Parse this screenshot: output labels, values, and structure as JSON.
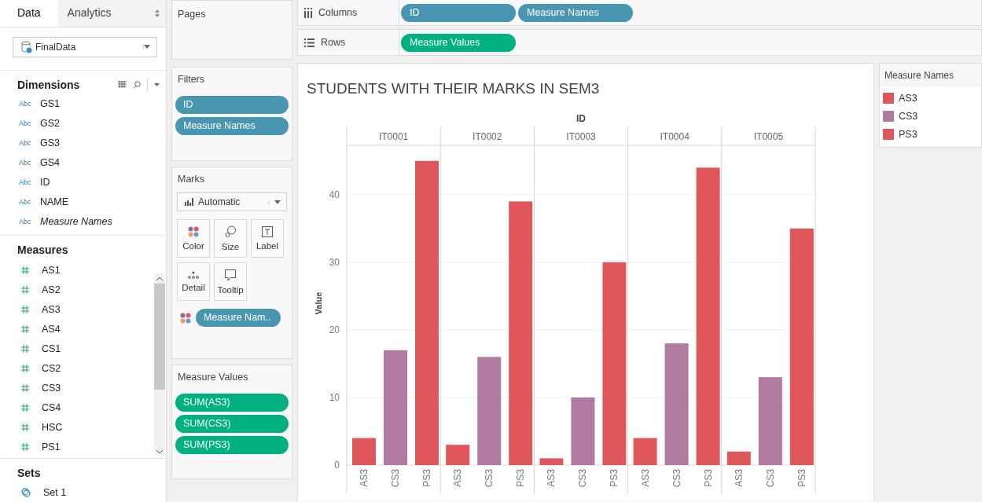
{
  "sidebar": {
    "tabs": [
      {
        "label": "Data",
        "selected": true
      },
      {
        "label": "Analytics",
        "selected": false
      }
    ],
    "data_source": "FinalData",
    "dimensions": {
      "title": "Dimensions",
      "items": [
        {
          "type_label": "Abc",
          "name": "GS1",
          "italic": false
        },
        {
          "type_label": "Abc",
          "name": "GS2",
          "italic": false
        },
        {
          "type_label": "Abc",
          "name": "GS3",
          "italic": false
        },
        {
          "type_label": "Abc",
          "name": "GS4",
          "italic": false
        },
        {
          "type_label": "Abc",
          "name": "ID",
          "italic": false
        },
        {
          "type_label": "Abc",
          "name": "NAME",
          "italic": false
        },
        {
          "type_label": "Abc",
          "name": "Measure Names",
          "italic": true
        }
      ]
    },
    "measures": {
      "title": "Measures",
      "items": [
        "AS1",
        "AS2",
        "AS3",
        "AS4",
        "CS1",
        "CS2",
        "CS3",
        "CS4",
        "HSC",
        "PS1"
      ]
    },
    "sets": {
      "title": "Sets",
      "items": [
        "Set 1"
      ]
    }
  },
  "pages": {
    "title": "Pages"
  },
  "filters": {
    "title": "Filters",
    "pills": [
      "ID",
      "Measure Names"
    ]
  },
  "marks": {
    "title": "Marks",
    "mark_type": "Automatic",
    "cards": [
      {
        "kind": "color",
        "label": "Color"
      },
      {
        "kind": "size",
        "label": "Size"
      },
      {
        "kind": "label",
        "label": "Label"
      },
      {
        "kind": "detail",
        "label": "Detail"
      },
      {
        "kind": "tooltip",
        "label": "Tooltip"
      }
    ],
    "color_pill": "Measure Nam.."
  },
  "measure_values": {
    "title": "Measure Values",
    "pills": [
      "SUM(AS3)",
      "SUM(CS3)",
      "SUM(PS3)"
    ]
  },
  "columns_shelf": {
    "label": "Columns",
    "pills": [
      {
        "text": "ID",
        "kind": "dimension"
      },
      {
        "text": "Measure Names",
        "kind": "dimension"
      }
    ]
  },
  "rows_shelf": {
    "label": "Rows",
    "pills": [
      {
        "text": "Measure Values",
        "kind": "measure"
      }
    ]
  },
  "view": {
    "title": "STUDENTS WITH THEIR MARKS IN SEM3",
    "chart_data": {
      "type": "bar",
      "xlabel": "ID",
      "ylabel": "Value",
      "categories": [
        "IT0001",
        "IT0002",
        "IT0003",
        "IT0004",
        "IT0005"
      ],
      "series": [
        {
          "name": "AS3",
          "color": "#e0575b",
          "values": [
            4,
            3,
            1,
            4,
            2
          ]
        },
        {
          "name": "CS3",
          "color": "#b07aa1",
          "values": [
            17,
            16,
            10,
            18,
            13
          ]
        },
        {
          "name": "PS3",
          "color": "#e0575b",
          "values": [
            45,
            39,
            30,
            44,
            35
          ]
        }
      ],
      "yticks": [
        0,
        10,
        20,
        30,
        40
      ],
      "ylim": [
        0,
        47.3
      ],
      "grid": true
    }
  },
  "legend": {
    "title": "Measure Names",
    "items": [
      {
        "name": "AS3",
        "color": "#e0575b"
      },
      {
        "name": "CS3",
        "color": "#b07aa1"
      },
      {
        "name": "PS3",
        "color": "#e0575b"
      }
    ]
  }
}
